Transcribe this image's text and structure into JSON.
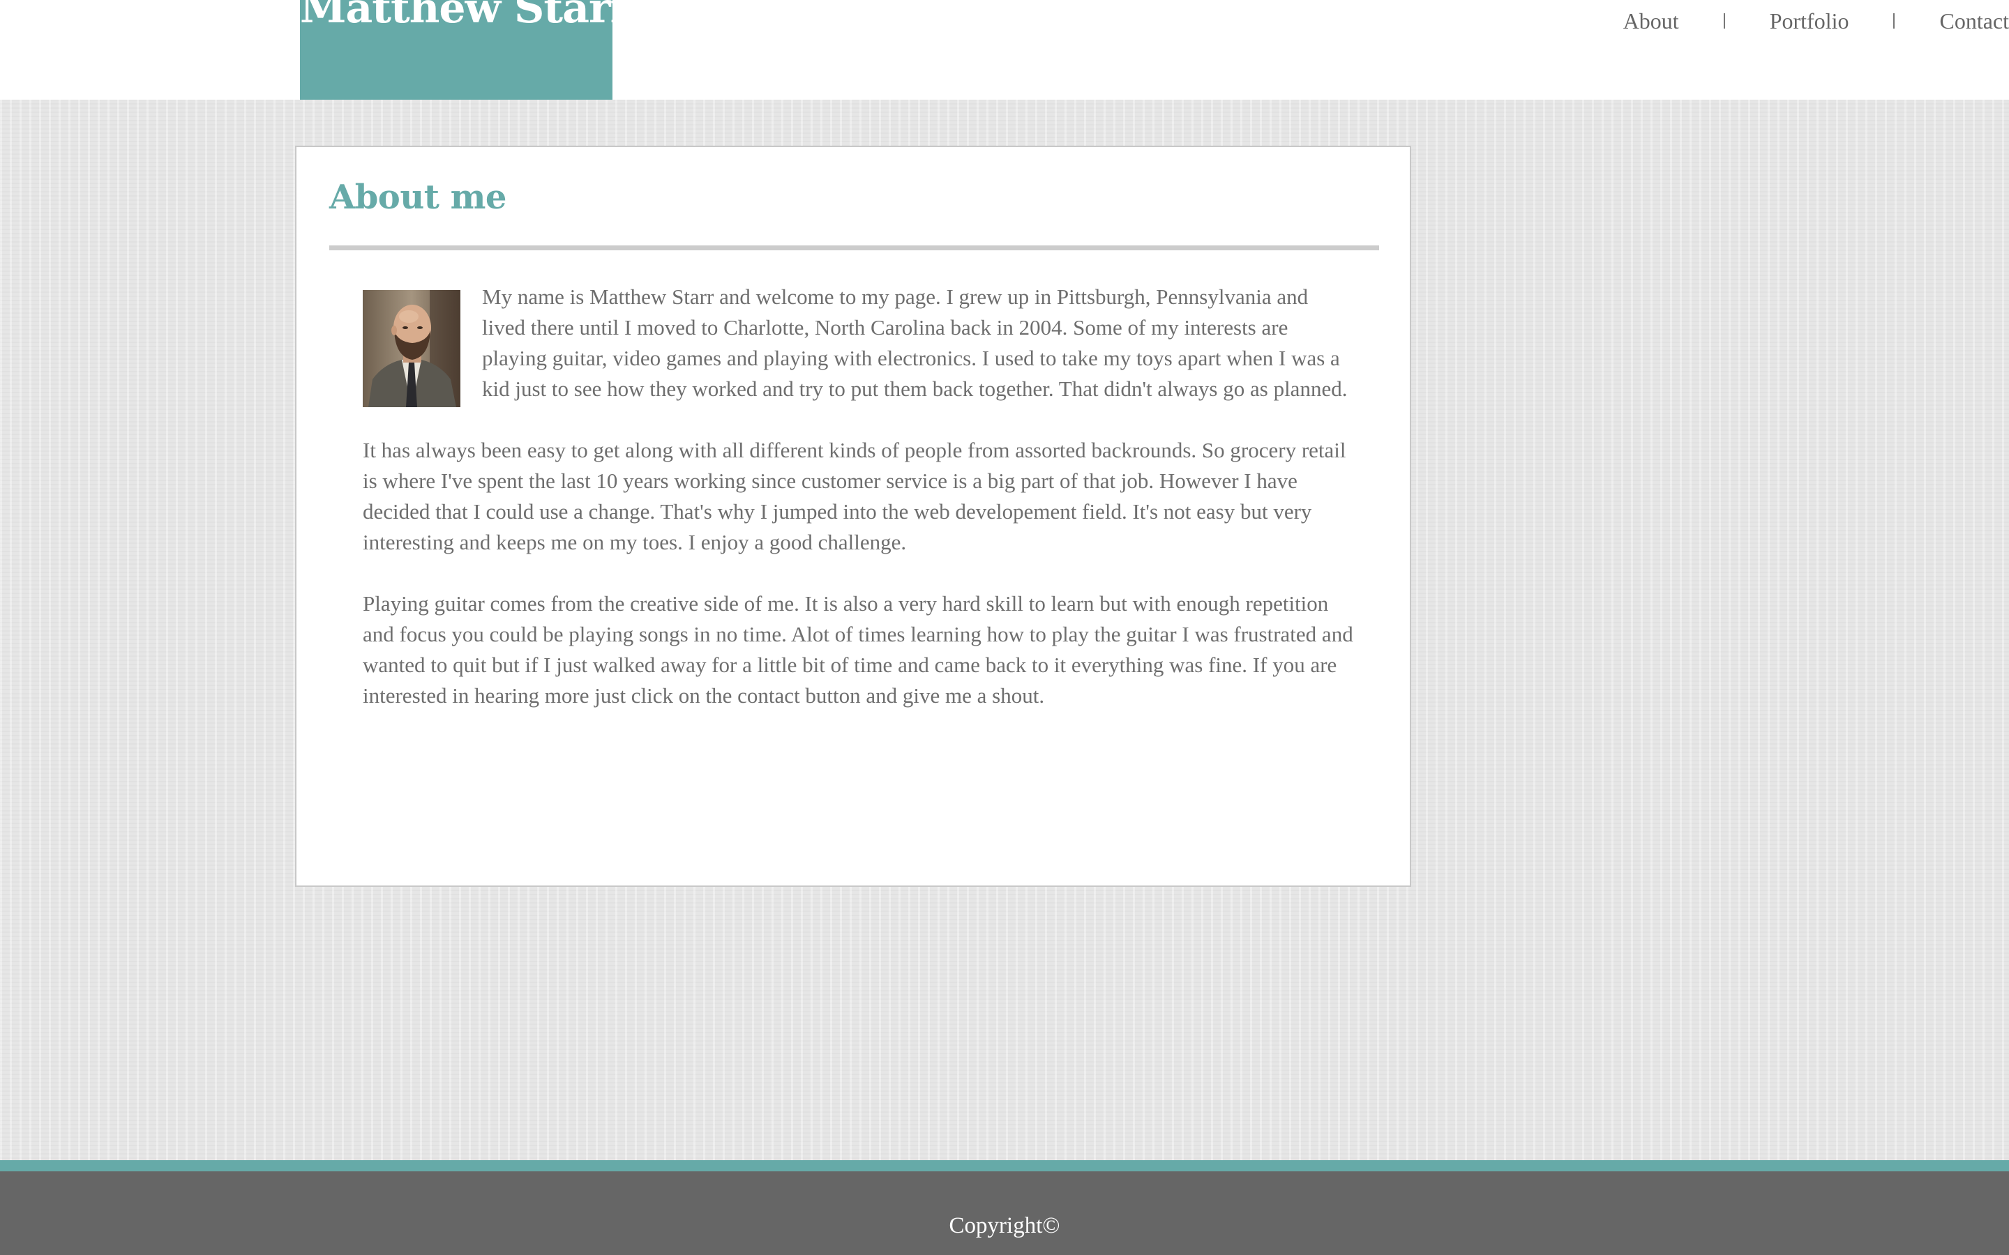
{
  "header": {
    "site_name": "Matthew Starr",
    "nav": {
      "about": "About",
      "separator_1": "|",
      "portfolio": "Portfolio",
      "separator_2": "|",
      "contact": "Contact"
    }
  },
  "main": {
    "title": "About me",
    "portrait_icon": "portrait-photo",
    "paragraphs": [
      "My name is Matthew Starr and welcome to my page. I grew up in Pittsburgh, Pennsylvania and lived there until I moved to Charlotte, North Carolina back in 2004. Some of my interests are playing guitar, video games and playing with electronics. I used to take my toys apart when I was a kid just to see how they worked and try to put them back together. That didn't always go as planned.",
      "It has always been easy to get along with all different kinds of people from assorted backrounds. So grocery retail is where I've spent the last 10 years working since customer service is a big part of that job. However I have decided that I could use a change. That's why I jumped into the web developement field. It's not easy but very interesting and keeps me on my toes. I enjoy a good challenge.",
      "Playing guitar comes from the creative side of me. It is also a very hard skill to learn but with enough repetition and focus you could be playing songs in no time. Alot of times learning how to play the guitar I was frustrated and wanted to quit but if I just walked away for a little bit of time and came back to it everything was fine. If you are interested in hearing more just click on the contact button and give me a shout."
    ]
  },
  "footer": {
    "copyright": "Copyright©"
  },
  "colors": {
    "accent": "#66aaa8",
    "footer_bg": "#666666",
    "text": "#6e6e6e"
  }
}
